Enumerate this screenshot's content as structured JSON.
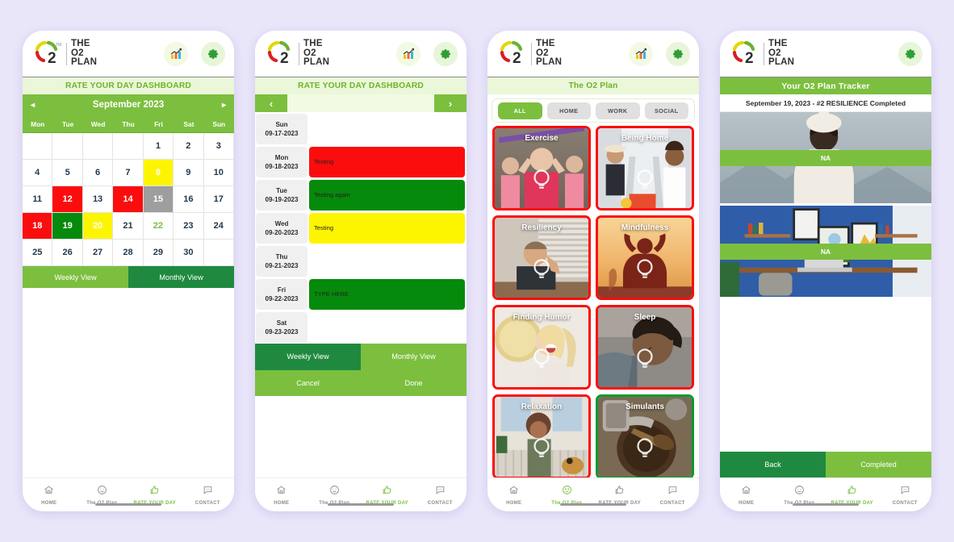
{
  "brand": {
    "name_line1": "THE",
    "name_line2": "O2",
    "name_line3": "PLAN",
    "logo_numeral": "2",
    "tm": "™",
    "accent_green": "#7cbf3f",
    "dark_green": "#1f8a3f",
    "red": "#fb0d0d",
    "yellow": "#fdf500",
    "grey": "#9e9e9e",
    "page_bg": "#eae6fa"
  },
  "nav": {
    "items": [
      {
        "label": "HOME",
        "icon": "home-icon"
      },
      {
        "label": "The O2 Plan",
        "icon": "smiley-icon"
      },
      {
        "label": "RATE YOUR DAY",
        "icon": "thumbs-up-icon"
      },
      {
        "label": "CONTACT",
        "icon": "chat-bubble-icon"
      }
    ]
  },
  "header_icons": {
    "chart": "bar-chart-icon",
    "gear": "gear-icon"
  },
  "phone1": {
    "title": "RATE YOUR DAY DASHBOARD",
    "month_label": "September 2023",
    "prev_arrow": "◂",
    "next_arrow": "▸",
    "dow": [
      "Mon",
      "Tue",
      "Wed",
      "Thu",
      "Fri",
      "Sat",
      "Sun"
    ],
    "cells": [
      {
        "n": "",
        "state": "empty"
      },
      {
        "n": "",
        "state": "empty"
      },
      {
        "n": "",
        "state": "empty"
      },
      {
        "n": "",
        "state": "empty"
      },
      {
        "n": "1",
        "state": ""
      },
      {
        "n": "2",
        "state": ""
      },
      {
        "n": "3",
        "state": ""
      },
      {
        "n": "4",
        "state": ""
      },
      {
        "n": "5",
        "state": ""
      },
      {
        "n": "6",
        "state": ""
      },
      {
        "n": "7",
        "state": ""
      },
      {
        "n": "8",
        "state": "yellow"
      },
      {
        "n": "9",
        "state": ""
      },
      {
        "n": "10",
        "state": ""
      },
      {
        "n": "11",
        "state": ""
      },
      {
        "n": "12",
        "state": "red"
      },
      {
        "n": "13",
        "state": ""
      },
      {
        "n": "14",
        "state": "red"
      },
      {
        "n": "15",
        "state": "grey"
      },
      {
        "n": "16",
        "state": ""
      },
      {
        "n": "17",
        "state": ""
      },
      {
        "n": "18",
        "state": "red"
      },
      {
        "n": "19",
        "state": "green"
      },
      {
        "n": "20",
        "state": "yellow"
      },
      {
        "n": "21",
        "state": ""
      },
      {
        "n": "22",
        "state": "today"
      },
      {
        "n": "23",
        "state": ""
      },
      {
        "n": "24",
        "state": ""
      },
      {
        "n": "25",
        "state": ""
      },
      {
        "n": "26",
        "state": ""
      },
      {
        "n": "27",
        "state": ""
      },
      {
        "n": "28",
        "state": ""
      },
      {
        "n": "29",
        "state": ""
      },
      {
        "n": "30",
        "state": ""
      },
      {
        "n": "",
        "state": "empty"
      }
    ],
    "weekly_view": "Weekly View",
    "monthly_view": "Monthly View",
    "active_nav": 2
  },
  "phone2": {
    "title": "RATE YOUR DAY DASHBOARD",
    "prev_arrow": "‹",
    "next_arrow": "›",
    "rows": [
      {
        "day": "Sun",
        "date": "09-17-2023",
        "entry": "",
        "color": "none"
      },
      {
        "day": "Mon",
        "date": "09-18-2023",
        "entry": "Testing",
        "color": "red"
      },
      {
        "day": "Tue",
        "date": "09-19-2023",
        "entry": "Testing again",
        "color": "green"
      },
      {
        "day": "Wed",
        "date": "09-20-2023",
        "entry": "Testing",
        "color": "yellow"
      },
      {
        "day": "Thu",
        "date": "09-21-2023",
        "entry": "",
        "color": "none"
      },
      {
        "day": "Fri",
        "date": "09-22-2023",
        "entry": "TYPE HERE",
        "color": "green"
      },
      {
        "day": "Sat",
        "date": "09-23-2023",
        "entry": "",
        "color": "none"
      }
    ],
    "buttons": [
      "Weekly View",
      "Monthly View",
      "Cancel",
      "Done"
    ],
    "active_nav": 2
  },
  "phone3": {
    "title": "The O2 Plan",
    "filters": [
      "ALL",
      "HOME",
      "WORK",
      "SOCIAL"
    ],
    "active_filter": 0,
    "cards": [
      {
        "title": "Exercise",
        "status": "red"
      },
      {
        "title": "Being Home",
        "status": "red"
      },
      {
        "title": "Resiliency",
        "status": "red"
      },
      {
        "title": "Mindfulness",
        "status": "red"
      },
      {
        "title": "Finding Humor",
        "status": "red"
      },
      {
        "title": "Sleep",
        "status": "red"
      },
      {
        "title": "Relaxation",
        "status": "red"
      },
      {
        "title": "Simulants",
        "status": "green"
      }
    ],
    "active_nav": 1
  },
  "phone4": {
    "title": "Your O2 Plan Tracker",
    "subtitle": "September 19, 2023 - #2 RESILIENCE Completed",
    "items": [
      {
        "band": "NA",
        "scene": "winter-portrait"
      },
      {
        "band": "NA",
        "scene": "blue-office"
      }
    ],
    "back_label": "Back",
    "completed_label": "Completed",
    "active_nav": 2
  }
}
